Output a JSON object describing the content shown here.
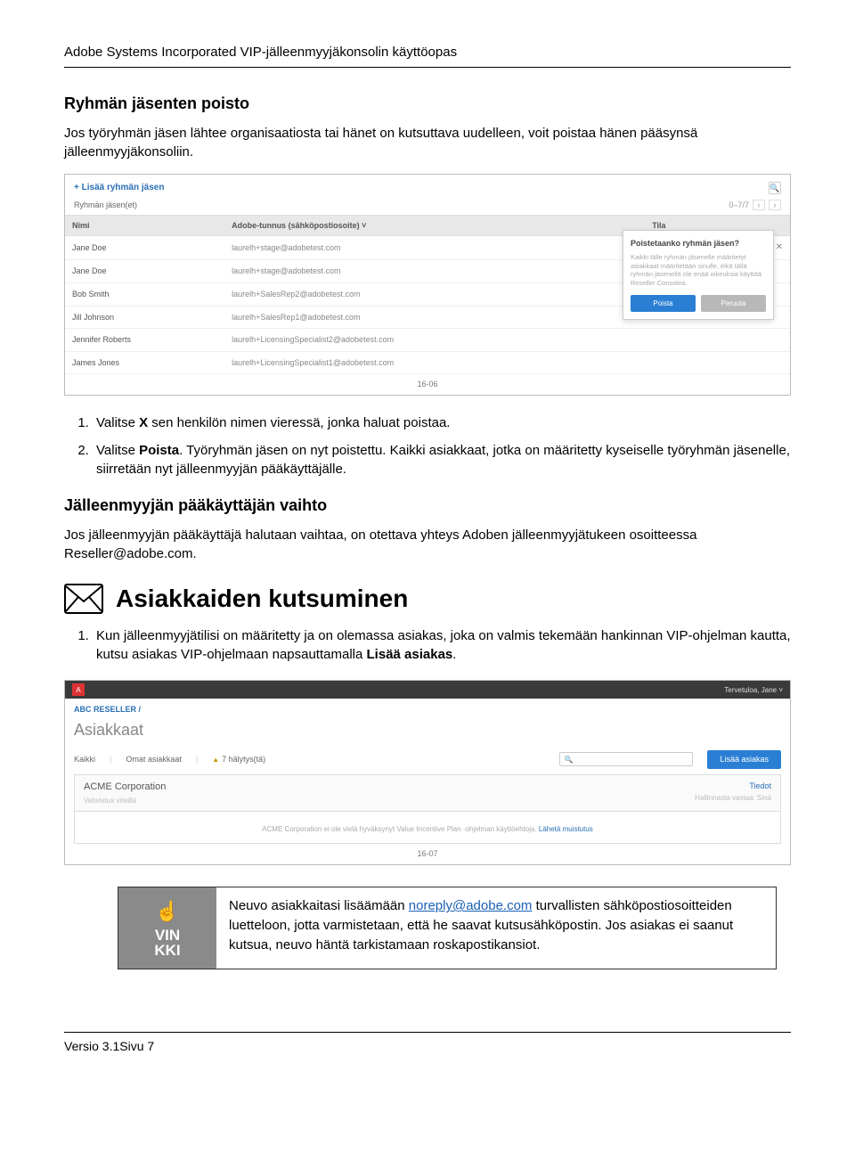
{
  "header": "Adobe Systems Incorporated VIP-jälleenmyyjäkonsolin käyttöopas",
  "sec1": {
    "title": "Ryhmän jäsenten poisto",
    "intro": "Jos työryhmän jäsen lähtee organisaatiosta tai hänet on kutsuttava uudelleen, voit poistaa hänen pääsynsä jälleenmyyjäkonsoliin."
  },
  "ss1": {
    "addLink": "+ Lisää ryhmän jäsen",
    "subLabel": "Ryhmän jäsen(et)",
    "pagination": "0–7/7",
    "prev": "‹",
    "next": "›",
    "colName": "Nimi",
    "colEmail": "Adobe-tunnus (sähköpostiosoite)  ˅",
    "colStatus": "Tila",
    "rows": [
      {
        "name": "Jane Doe",
        "email": "laurelh+stage@adobetest.com",
        "x": "✕"
      },
      {
        "name": "Jane Doe",
        "email": "laurelh+stage@adobetest.com"
      },
      {
        "name": "Bob Smith",
        "email": "laurelh+SalesRep2@adobetest.com"
      },
      {
        "name": "Jill Johnson",
        "email": "laurelh+SalesRep1@adobetest.com"
      },
      {
        "name": "Jennifer Roberts",
        "email": "laurelh+LicensingSpecialist2@adobetest.com"
      },
      {
        "name": "James Jones",
        "email": "laurelh+LicensingSpecialist1@adobetest.com"
      }
    ],
    "popover": {
      "title": "Poistetaanko ryhmän jäsen?",
      "text": "Kaikki tälle ryhmän jäsenelle määritetyt asiakkaat määritetään sinulle, eikä tällä ryhmän jäsenellä ole enää oikeuksia käyttää Reseller Consolea.",
      "delete": "Poista",
      "cancel": "Peruuta"
    },
    "fig": "16-06"
  },
  "steps1": {
    "s1a": "Valitse ",
    "s1b": " sen henkilön nimen vieressä, jonka haluat poistaa.",
    "s1x": "X",
    "s2a": "Valitse ",
    "s2b": "Poista",
    "s2c": ". Työryhmän jäsen on nyt poistettu. Kaikki asiakkaat, jotka on määritetty kyseiselle työryhmän jäsenelle, siirretään nyt jälleenmyyjän pääkäyttäjälle."
  },
  "sec2": {
    "title": "Jälleenmyyjän pääkäyttäjän vaihto",
    "body": "Jos jälleenmyyjän pääkäyttäjä halutaan vaihtaa, on otettava yhteys Adoben jälleenmyyjätukeen osoitteessa Reseller@adobe.com."
  },
  "sec3": {
    "title": "Asiakkaiden kutsuminen",
    "s1a": "Kun jälleenmyyjätilisi on määritetty ja on olemassa asiakas, joka on valmis tekemään hankinnan VIP-ohjelman kautta, kutsu asiakas VIP-ohjelmaan napsauttamalla ",
    "s1b": "Lisää asiakas",
    "s1c": "."
  },
  "ss2": {
    "logo": "A",
    "welcome": "Tervetuloa, Jane ˅",
    "crumb": "ABC RESELLER /",
    "heading": "Asiakkaat",
    "tabAll": "Kaikki",
    "tabOwn": "Omat asiakkaat",
    "tabAlert": "7 hälytys(tä)",
    "searchIcon": "🔍",
    "addBtn": "Lisää asiakas",
    "custName": "ACME Corporation",
    "custStatus": "Vahvistus vireillä",
    "tiedot": "Tiedot",
    "hallinta": "Hallinnasta vastaa: Sinä",
    "msg1": "ACME Corporation ei ole vielä hyväksynyt Value Incentive Plan -ohjelman käyttöehtoja. ",
    "msgLink": "Lähetä muistutus",
    "fig": "16-07"
  },
  "tip": {
    "label1": "VIN",
    "label2": "KKI",
    "text1": "Neuvo asiakkaitasi lisäämään ",
    "link": "noreply@adobe.com",
    "text2": " turvallisten sähköpostiosoitteiden luetteloon, jotta varmistetaan, että he saavat kutsusähköpostin. Jos asiakas ei saanut kutsua, neuvo häntä tarkistamaan roskapostikansiot."
  },
  "footer": "Versio 3.1Sivu 7"
}
